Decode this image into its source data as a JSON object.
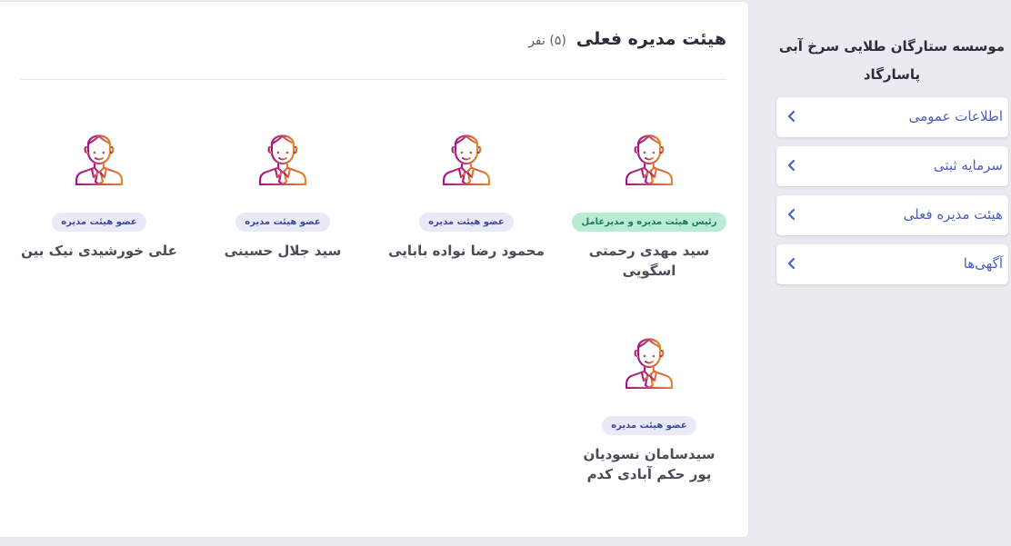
{
  "board": {
    "title": "هیئت مدیره فعلی",
    "count": "(۵) نفر",
    "members": [
      {
        "name": "سید مهدی رحمتی اسگویی",
        "role": "رئیس هیئت مدیره و مدیرعامل"
      },
      {
        "name": "محمود رضا نواده بابایی",
        "role": "عضو هیئت مدیره"
      },
      {
        "name": "سید جلال حسینی",
        "role": "عضو هیئت مدیره"
      },
      {
        "name": "علی خورشیدی نیک بین",
        "role": "عضو هیئت مدیره"
      },
      {
        "name": "سیدسامان نسودیان پور حکم آبادی کدم",
        "role": "عضو هیئت مدیره"
      }
    ]
  },
  "sidebar": {
    "company_name": "موسسه ستارگان طلایی سرخ آبی پاسارگاد",
    "items": [
      {
        "label": "اطلاعات عمومی"
      },
      {
        "label": "سرمایه ثبتی"
      },
      {
        "label": "هیئت مدیره فعلی"
      },
      {
        "label": "آگهی‌ها"
      }
    ]
  },
  "colors": {
    "accent": "#4a5fbf",
    "ceo_badge_bg": "#b9ecd5",
    "member_badge_bg": "#e8ebf7",
    "avatar_gradient": [
      "#a2148c",
      "#e0892b"
    ]
  },
  "icons": {
    "avatar": "person-tie-icon",
    "nav_arrow": "chevron-left-icon"
  }
}
